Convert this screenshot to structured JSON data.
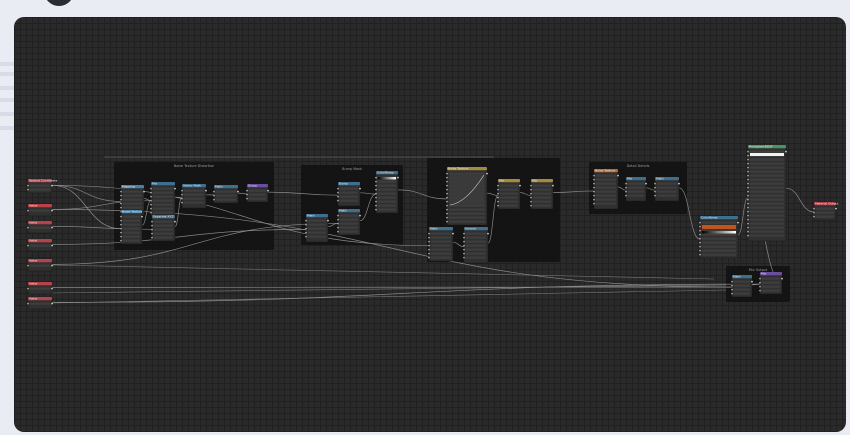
{
  "page": {
    "background": "#e9ecf2"
  },
  "editor": {
    "background": "#2a2a2a",
    "grid_color": "#202020",
    "wire_color": "#9a9a9a"
  },
  "colors": {
    "input_header": "#b8424a",
    "vector_header": "#4a7fa6",
    "converter_header": "#3f6f8f",
    "shader_header": "#4a9460",
    "output_header": "#b03a43",
    "texture_header": "#b76a30",
    "color_header": "#a48a3a",
    "group_header": "#6a4fa0",
    "node_body": "#303030",
    "frame_body": "#121212"
  },
  "frames": [
    {
      "id": "f1",
      "label": "Noise Texture Distortion"
    },
    {
      "id": "f2",
      "label": "Bump Mask"
    },
    {
      "id": "f3",
      "label": ""
    },
    {
      "id": "f4",
      "label": "Detail Details"
    },
    {
      "id": "f5",
      "label": "Mix Output"
    }
  ],
  "nodes": [
    {
      "id": "in1",
      "title": "Texture Coordinate",
      "kind": "input"
    },
    {
      "id": "in2",
      "title": "Value",
      "kind": "input"
    },
    {
      "id": "in3",
      "title": "Value",
      "kind": "input"
    },
    {
      "id": "in4",
      "title": "Value",
      "kind": "input"
    },
    {
      "id": "in5",
      "title": "Value",
      "kind": "input"
    },
    {
      "id": "in6",
      "title": "Value",
      "kind": "input"
    },
    {
      "id": "in7",
      "title": "Value",
      "kind": "input"
    },
    {
      "id": "n1",
      "title": "Mapping",
      "kind": "vector"
    },
    {
      "id": "n2",
      "title": "Noise Texture",
      "kind": "vector"
    },
    {
      "id": "n3",
      "title": "Mix",
      "kind": "converter"
    },
    {
      "id": "n4",
      "title": "Vector Math",
      "kind": "converter"
    },
    {
      "id": "n5",
      "title": "Math",
      "kind": "converter"
    },
    {
      "id": "n6",
      "title": "Group",
      "kind": "group"
    },
    {
      "id": "n7",
      "title": "Separate XYZ",
      "kind": "converter"
    },
    {
      "id": "n8",
      "title": "Math",
      "kind": "converter"
    },
    {
      "id": "n9",
      "title": "Math",
      "kind": "converter"
    },
    {
      "id": "n10",
      "title": "Bump",
      "kind": "converter"
    },
    {
      "id": "n11",
      "title": "ColorRamp",
      "kind": "converter"
    },
    {
      "id": "n12",
      "title": "Mix",
      "kind": "color"
    },
    {
      "id": "n13",
      "title": "Mix",
      "kind": "color"
    },
    {
      "id": "n14",
      "title": "Noise Texture",
      "kind": "color"
    },
    {
      "id": "n15",
      "title": "Math",
      "kind": "converter"
    },
    {
      "id": "n16",
      "title": "Voronoi",
      "kind": "converter"
    },
    {
      "id": "n17",
      "title": "Noise Texture",
      "kind": "texture"
    },
    {
      "id": "n18",
      "title": "Mix",
      "kind": "converter"
    },
    {
      "id": "n19",
      "title": "Math",
      "kind": "converter"
    },
    {
      "id": "n20",
      "title": "ColorRamp",
      "kind": "converter"
    },
    {
      "id": "n21",
      "title": "Principled BSDF",
      "kind": "shader"
    },
    {
      "id": "n22",
      "title": "Math",
      "kind": "converter"
    },
    {
      "id": "n23",
      "title": "Mix",
      "kind": "group"
    },
    {
      "id": "out1",
      "title": "Material Output",
      "kind": "output"
    }
  ]
}
